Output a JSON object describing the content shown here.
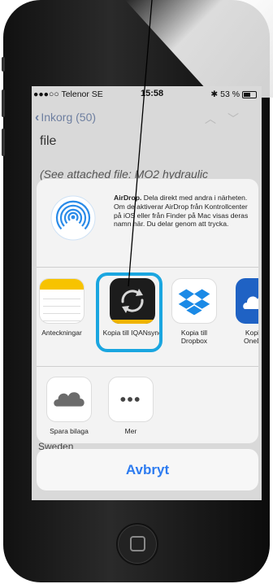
{
  "status_bar": {
    "carrier": "●●●○○ Telenor SE",
    "time": "15:58",
    "battery": "53 %"
  },
  "mail_nav": {
    "back_label": "Inkorg (50)"
  },
  "mail_body": {
    "text_top": "file",
    "text_italic": "(See attached file: MO2 hydraulic",
    "text_bottom": "Sweden"
  },
  "share_sheet": {
    "airdrop": {
      "title": "AirDrop.",
      "description": "Dela direkt med andra i närheten. Om de aktiverar AirDrop från Kontrollcenter på iOS eller från Finder på Mac visas deras namn här. Du delar genom att trycka."
    },
    "apps": [
      {
        "label": "Anteckningar",
        "icon": "notes-icon"
      },
      {
        "label": "Kopia till IQANsync",
        "icon": "iqansync-sync-icon"
      },
      {
        "label": "Kopia till Dropbox",
        "icon": "dropbox-icon"
      },
      {
        "label": "Kopia till OneDrive",
        "icon": "onedrive-icon"
      }
    ],
    "actions": [
      {
        "label": "Spara bilaga",
        "icon": "icloud-icon"
      },
      {
        "label": "Mer",
        "icon": "more-icon"
      }
    ],
    "cancel_label": "Avbryt"
  },
  "colors": {
    "accent": "#2d7bf0",
    "highlight": "#1aa6e0",
    "notes_yellow": "#f7c300",
    "onedrive_blue": "#1f62c4"
  }
}
